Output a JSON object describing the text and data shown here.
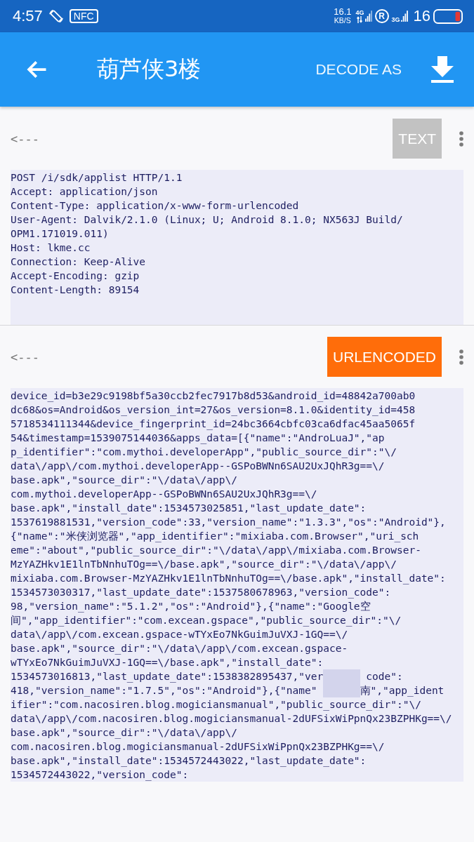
{
  "status_bar": {
    "time": "4:57",
    "nfc": "NFC",
    "speed_value": "16.1",
    "speed_unit": "KB/S",
    "network_1": "4G",
    "roaming": "R",
    "network_2": "3G",
    "battery": "16"
  },
  "app_bar": {
    "title": "葫芦侠3楼",
    "action": "DECODE AS"
  },
  "sections": [
    {
      "direction": "<---",
      "format": "TEXT",
      "color": "#c2c2c2",
      "lines": [
        [
          "POST /i/sdk/applist HTTP/1.1"
        ],
        [
          "Accept: application/json"
        ],
        [
          "Content-Type: application/x-www-form-urlencoded"
        ],
        [
          "User-Agent: Dalvik/2.1.0 (Linux; U; Android 8.1.0; NX563J Build/"
        ],
        [
          "OPM1.171019.011)"
        ],
        [
          "Host: lkme.cc"
        ],
        [
          "Connection: Keep-Alive"
        ],
        [
          "Accept-Encoding: gzip"
        ],
        [
          "Content-Length: 89154"
        ]
      ]
    },
    {
      "direction": "<---",
      "format": "URLENCODED",
      "color": "#ff6d0a",
      "lines": [
        [
          "device_id=b3e29c9198bf5a30ccb2fec7917b8d53&android_id=48842a700ab0"
        ],
        [
          "dc68&os=Android&os_version_int=27&os_version=8.1.0&identity_id=458"
        ],
        [
          "5718534111344&device_fingerprint_id=24bc3664cbfc03ca6dfac45aa5065f"
        ],
        [
          "54&timestamp=1539075144036&apps_data=[{\"name\":\"AndroLuaJ\",\"ap"
        ],
        [
          "p_identifier\":\"com.mythoi.developerApp\",\"public_source_dir\":\"\\/"
        ],
        [
          "data\\/app\\/com.mythoi.developerApp--GSPoBWNn6SAU2UxJQhR3g==\\/"
        ],
        [
          "base.apk\",\"source_dir\":\"\\/data\\/app\\/"
        ],
        [
          "com.mythoi.developerApp--GSPoBWNn6SAU2UxJQhR3g==\\/"
        ],
        [
          "base.apk\",\"install_date\":1534573025851,\"last_update_date\":"
        ],
        [
          "1537619881531,\"version_code\":33,\"version_name\":\"1.3.3\",\"os\":\"Android\"},"
        ],
        [
          "{\"name\":\"米侠浏览器\",\"app_identifier\":\"mixiaba.com.Browser\",\"uri_sch"
        ],
        [
          "eme\":\"about\",\"public_source_dir\":\"\\/data\\/app\\/mixiaba.com.Browser-"
        ],
        [
          "MzYAZHkv1E1lnTbNnhuTOg==\\/base.apk\",\"source_dir\":\"\\/data\\/app\\/"
        ],
        [
          "mixiaba.com.Browser-MzYAZHkv1E1lnTbNnhuTOg==\\/base.apk\",\"install_date\":"
        ],
        [
          "1534573030317,\"last_update_date\":1537580678963,\"version_code\":"
        ],
        [
          "98,\"version_name\":\"5.1.2\",\"os\":\"Android\"},{\"name\":\"Google空"
        ],
        [
          "间\",\"app_identifier\":\"com.excean.gspace\",\"public_source_dir\":\"\\/"
        ],
        [
          "data\\/app\\/com.excean.gspace-wTYxEo7NkGuimJuVXJ-1GQ==\\/"
        ],
        [
          "base.apk\",\"source_dir\":\"\\/data\\/app\\/com.excean.gspace-"
        ],
        [
          "wTYxEo7NkGuimJuVXJ-1GQ==\\/base.apk\",\"install_date\":"
        ],
        [
          "1534573016813,\"last_update_date\":1538382895437,\"ver",
          "code\":"
        ],
        [
          "418,\"version_name\":\"1.7.5\",\"os\":\"Android\"},{\"name\"",
          "南\",\"app_ident"
        ],
        [
          "ifier\":\"com.nacosiren.blog.mogiciansmanual\",\"public_source_dir\":\"\\/"
        ],
        [
          "data\\/app\\/com.nacosiren.blog.mogiciansmanual-2dUFSixWiPpnQx23BZPHKg==\\/"
        ],
        [
          "base.apk\",\"source_dir\":\"\\/data\\/app\\/"
        ],
        [
          "com.nacosiren.blog.mogiciansmanual-2dUFSixWiPpnQx23BZPHKg==\\/"
        ],
        [
          "base.apk\",\"install_date\":1534572443022,\"last_update_date\":"
        ],
        [
          "1534572443022,\"version_code\":"
        ]
      ]
    }
  ]
}
